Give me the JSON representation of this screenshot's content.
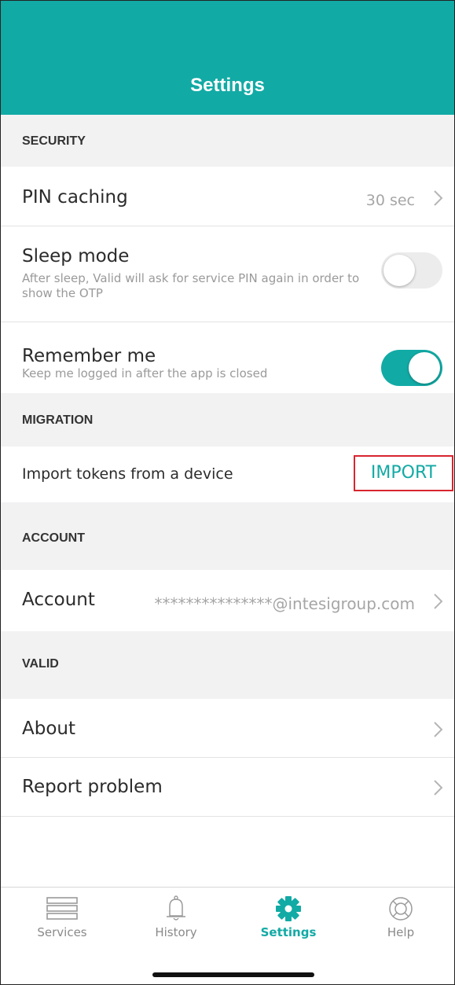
{
  "header": {
    "title": "Settings"
  },
  "sections": {
    "security": "SECURITY",
    "migration": "MIGRATION",
    "account": "ACCOUNT",
    "valid": "VALID"
  },
  "security": {
    "pin_caching": {
      "label": "PIN caching",
      "value": "30 sec"
    },
    "sleep_mode": {
      "label": "Sleep mode",
      "description": "After sleep, Valid will ask for service PIN again in order to show the OTP",
      "enabled": false
    },
    "remember_me": {
      "label": "Remember me",
      "description": "Keep me logged in after the app is closed",
      "enabled": true
    }
  },
  "migration": {
    "import_label": "Import tokens from a device",
    "import_button": "IMPORT"
  },
  "account": {
    "label": "Account",
    "value": "***************@intesigroup.com"
  },
  "valid": {
    "about": "About",
    "report_problem": "Report problem"
  },
  "tabs": [
    {
      "label": "Services",
      "icon": "services-icon",
      "active": false
    },
    {
      "label": "History",
      "icon": "bell-icon",
      "active": false
    },
    {
      "label": "Settings",
      "icon": "gear-icon",
      "active": true
    },
    {
      "label": "Help",
      "icon": "lifebuoy-icon",
      "active": false
    }
  ],
  "colors": {
    "accent": "#12aaa5",
    "highlight_border": "#d8252f",
    "section_bg": "#f2f2f3"
  }
}
